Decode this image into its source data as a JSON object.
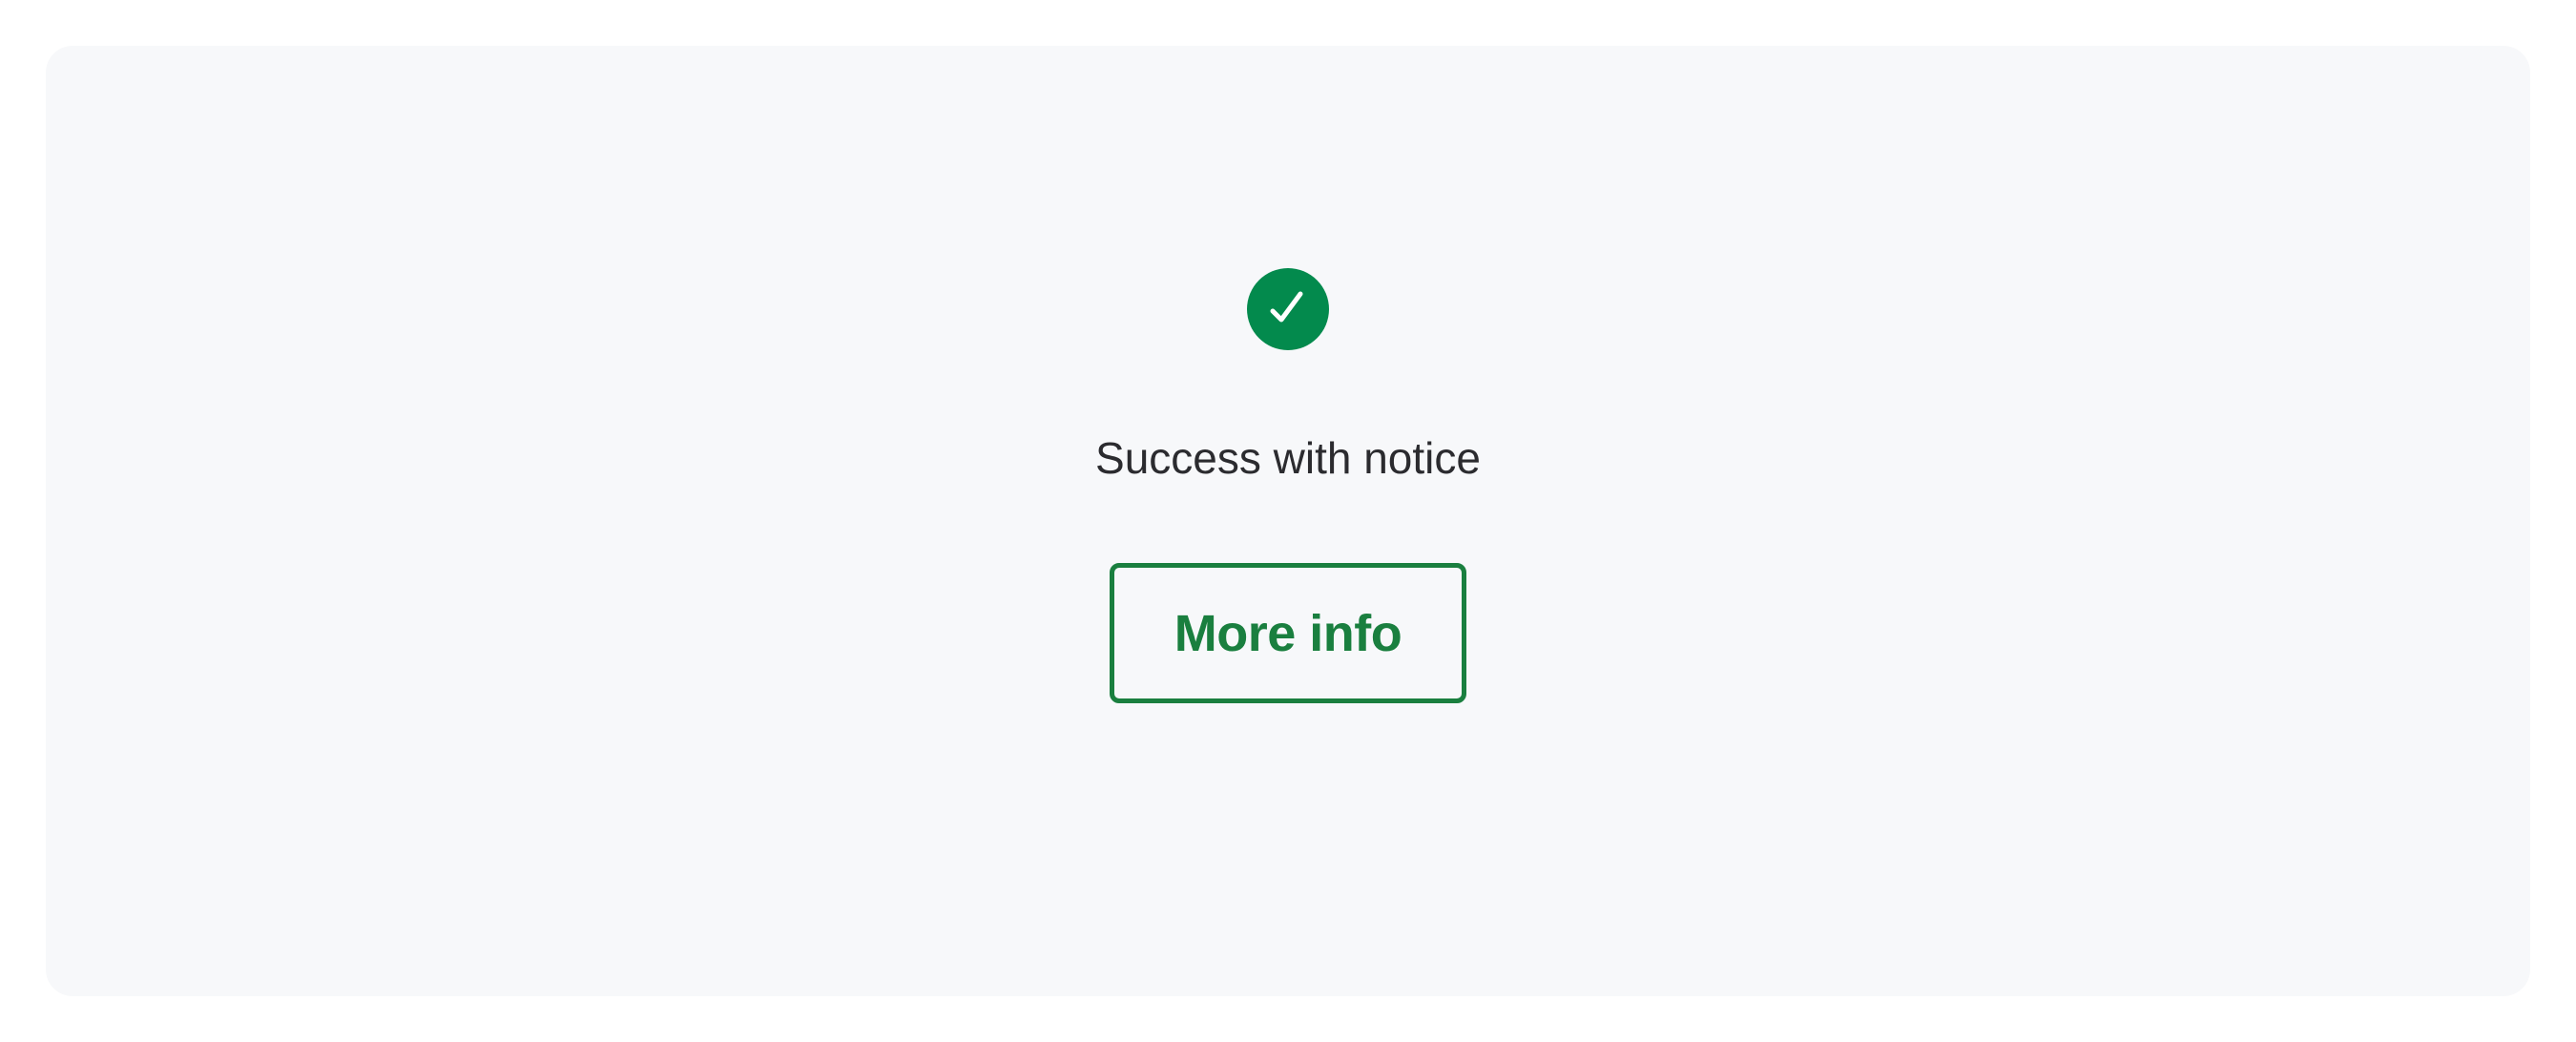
{
  "notice": {
    "icon": "check-circle-icon",
    "icon_color": "#038a4d",
    "message": "Success with notice"
  },
  "actions": {
    "more_info_label": "More info",
    "accent_color": "#1a7f3f"
  }
}
